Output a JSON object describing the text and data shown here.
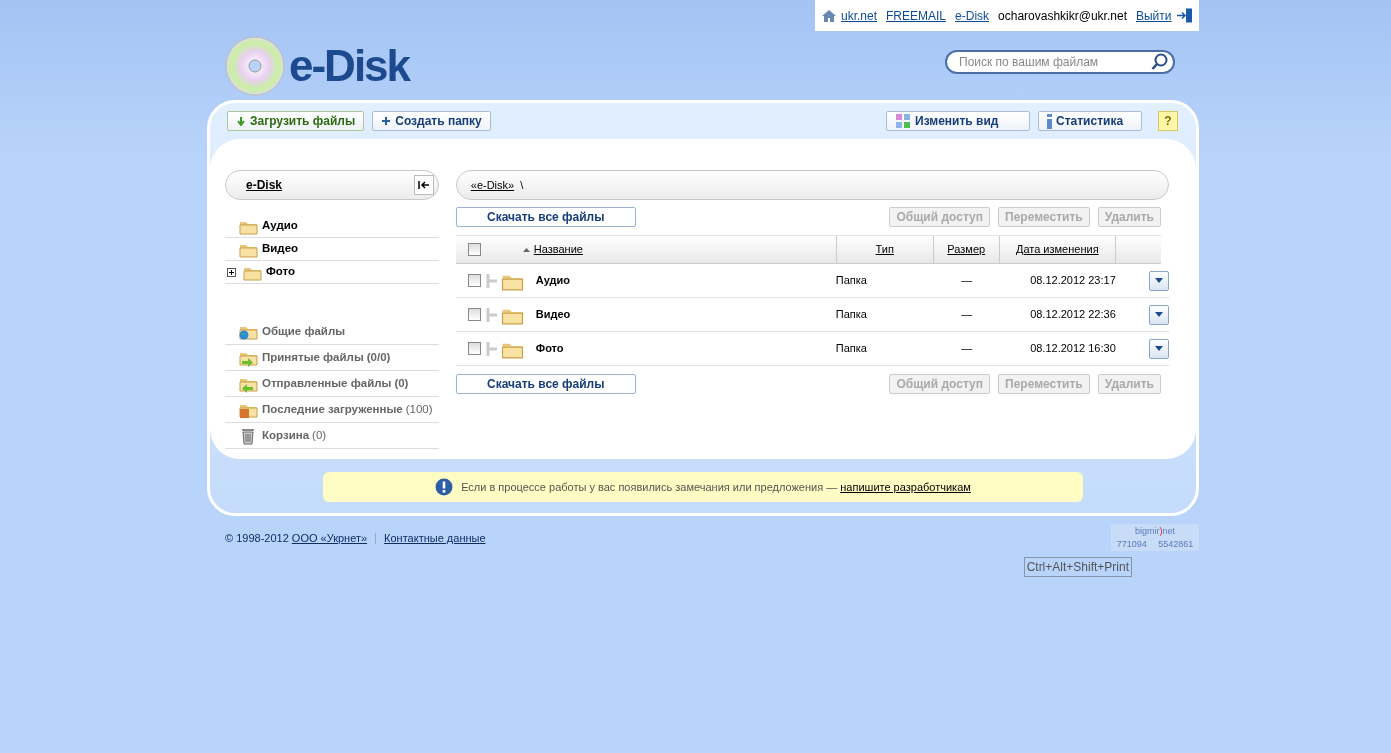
{
  "top_bar": {
    "links": [
      {
        "label": "ukr.net",
        "kind": "home"
      },
      {
        "label": "FREEMAIL",
        "kind": "plain"
      },
      {
        "label": "e-Disk",
        "kind": "plain"
      }
    ],
    "user": "ocharovashkikr@ukr.net",
    "logout": "Выйти"
  },
  "logo": {
    "text": "e-Disk"
  },
  "search": {
    "placeholder": "Поиск по вашим файлам"
  },
  "toolbar": {
    "left": [
      {
        "label": "Загрузить файлы",
        "kind": "upload"
      },
      {
        "label": "Создать папку",
        "kind": "new-folder"
      }
    ],
    "right": [
      {
        "label": "Изменить вид",
        "kind": "view"
      },
      {
        "label": "Статистика",
        "kind": "stats"
      }
    ],
    "help": "?"
  },
  "sidebar": {
    "title": "e-Disk",
    "folders": [
      {
        "label": "Аудио",
        "expandable": false
      },
      {
        "label": "Видео",
        "expandable": false
      },
      {
        "label": "Фото",
        "expandable": true
      }
    ],
    "special": [
      {
        "label": "Общие файлы",
        "kind": "shared"
      },
      {
        "label": "Принятые файлы",
        "count": "(0/0)",
        "count_bold": true,
        "kind": "received"
      },
      {
        "label": "Отправленные файлы",
        "count": "(0)",
        "count_bold": true,
        "kind": "sent"
      },
      {
        "label": "Последние загруженные",
        "count": "(100)",
        "count_bold": false,
        "kind": "recent"
      },
      {
        "label": "Корзина",
        "count": "(0)",
        "count_bold": false,
        "kind": "trash"
      }
    ]
  },
  "breadcrumb": {
    "items": [
      "«e-Disk»"
    ],
    "separator": "\\"
  },
  "action_bars": [
    {
      "download": "Скачать все файлы",
      "buttons": [
        {
          "label": "Общий доступ",
          "disabled": true
        },
        {
          "label": "Переместить",
          "disabled": true
        },
        {
          "label": "Удалить",
          "disabled": true
        }
      ]
    },
    {
      "download": "Скачать все файлы",
      "buttons": [
        {
          "label": "Общий доступ",
          "disabled": true
        },
        {
          "label": "Переместить",
          "disabled": true
        },
        {
          "label": "Удалить",
          "disabled": true
        }
      ]
    }
  ],
  "table": {
    "select_all": false,
    "columns": [
      {
        "label": "Название",
        "sorted": true
      },
      {
        "label": "Тип",
        "sorted": false
      },
      {
        "label": "Размер",
        "sorted": false
      },
      {
        "label": "Дата изменения",
        "sorted": false
      }
    ],
    "rows": [
      {
        "name": "Аудио",
        "type": "Папка",
        "size": "—",
        "date": "08.12.2012 23:17",
        "checked": false
      },
      {
        "name": "Видео",
        "type": "Папка",
        "size": "—",
        "date": "08.12.2012 22:36",
        "checked": false
      },
      {
        "name": "Фото",
        "type": "Папка",
        "size": "—",
        "date": "08.12.2012 16:30",
        "checked": false
      }
    ]
  },
  "notice": {
    "text": "Если в процессе работы у вас появились замечания или предложения — ",
    "link": "напишите разработчикам"
  },
  "footer": {
    "copyright": "© 1998-2012",
    "company": "ООО «Укрнет»",
    "contacts": "Контактные данные"
  },
  "counter": {
    "brand": "bigmir",
    "brand_mark": ")",
    "brand_suffix": "net",
    "values": [
      "771094",
      "5542861"
    ]
  },
  "hotkey": "Ctrl+Alt+Shift+Print"
}
